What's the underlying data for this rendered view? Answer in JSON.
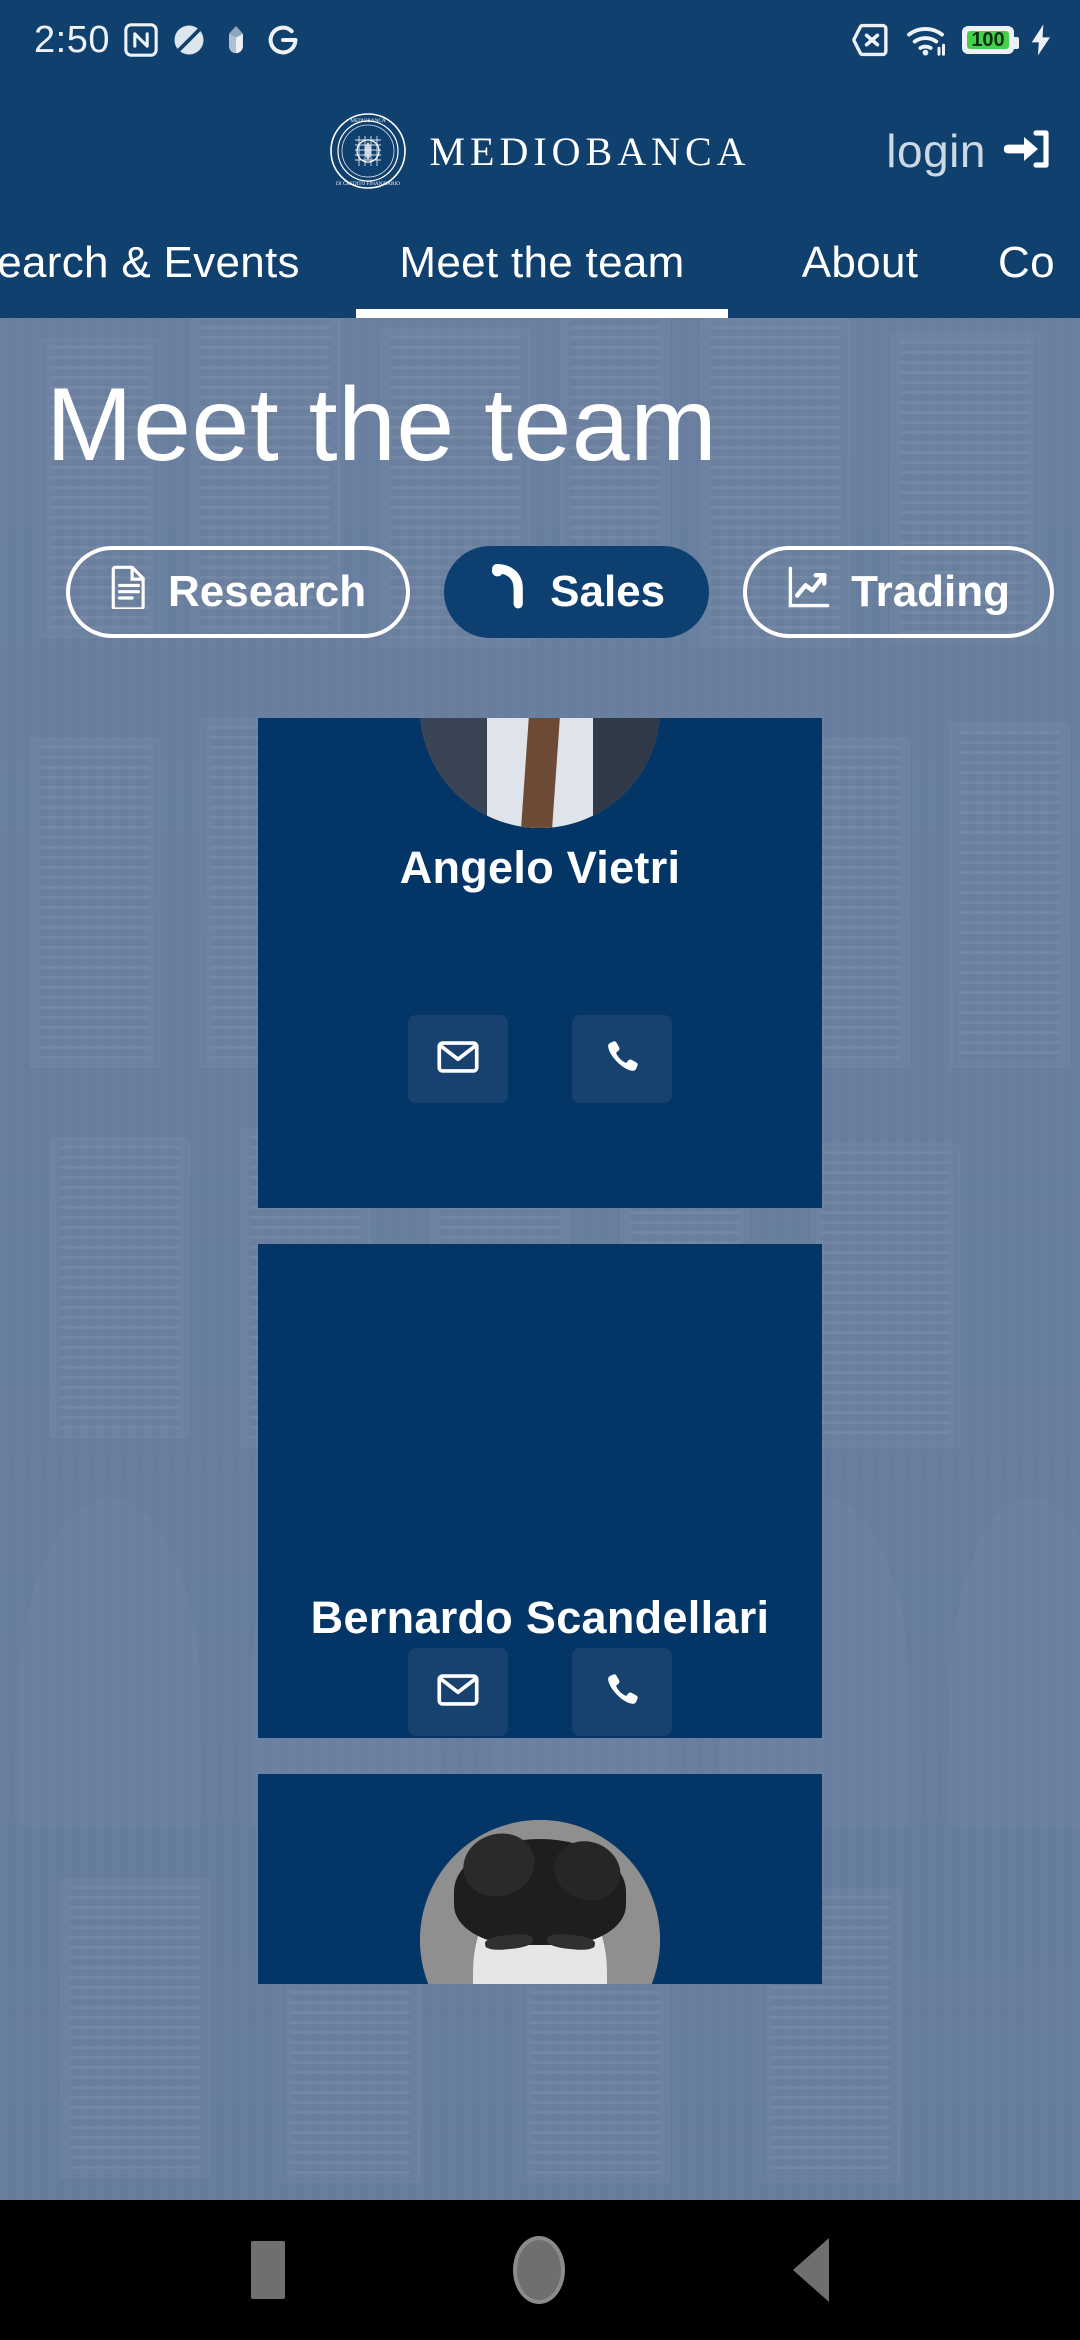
{
  "statusbar": {
    "time": "2:50",
    "left_icons": [
      "nfc-icon",
      "app-icon-dark",
      "tulip-icon",
      "google-icon"
    ],
    "right_icons": [
      "no-sim-icon",
      "wifi-icon",
      "battery-icon",
      "charging-bolt-icon"
    ],
    "battery_percent": "100",
    "battery_color": "#45d24a"
  },
  "header": {
    "brand": "MEDIOBANCA",
    "seal_label": "mediobanca-seal",
    "login_label": "login",
    "login_icon": "sign-in-icon",
    "background_color": "#10406e",
    "tabs": [
      {
        "label": "esearch & Events",
        "active": false
      },
      {
        "label": "Meet the team",
        "active": true
      },
      {
        "label": "About",
        "active": false
      },
      {
        "label": "Co",
        "active": false
      }
    ]
  },
  "hero": {
    "title": "Meet the team",
    "overlay_color": "#6b80a0",
    "filters": [
      {
        "label": "Research",
        "icon": "document-icon",
        "active": false
      },
      {
        "label": "Sales",
        "icon": "phone-handset-icon",
        "active": true
      },
      {
        "label": "Trading",
        "icon": "chart-line-icon",
        "active": false
      }
    ]
  },
  "team": {
    "card_color": "#033566",
    "action_button_color": "#17416e",
    "members": [
      {
        "name": "Angelo Vietri",
        "photo": "portrait-suit-tie",
        "has_photo": true,
        "email_icon": "envelope-icon",
        "phone_icon": "phone-icon"
      },
      {
        "name": "Bernardo Scandellari",
        "photo": "",
        "has_photo": false,
        "email_icon": "envelope-icon",
        "phone_icon": "phone-icon"
      },
      {
        "name": "",
        "photo": "portrait-dark-hair",
        "has_photo": true,
        "email_icon": "envelope-icon",
        "phone_icon": "phone-icon"
      }
    ]
  },
  "androidnav": {
    "recents": "recents-button",
    "home": "home-button",
    "back": "back-button"
  }
}
